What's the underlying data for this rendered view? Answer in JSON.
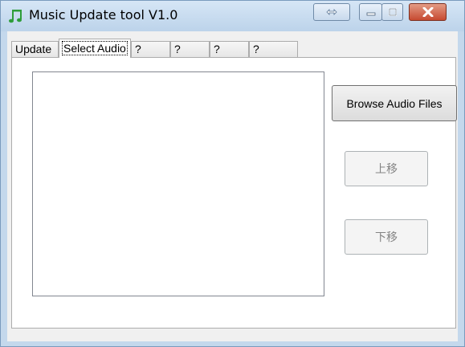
{
  "window": {
    "title": "Music Update tool V1.0"
  },
  "tabs": [
    {
      "label": "Update",
      "selected": false
    },
    {
      "label": "Select Audio",
      "selected": true
    },
    {
      "label": "?",
      "selected": false
    },
    {
      "label": "?",
      "selected": false
    },
    {
      "label": "?",
      "selected": false
    },
    {
      "label": "?",
      "selected": false
    }
  ],
  "buttons": {
    "browse": "Browse Audio Files",
    "move_up": "上移",
    "move_down": "下移"
  },
  "icons": {
    "app": "music-note-icon",
    "extra": "arrows-icon",
    "minimize": "minimize-icon",
    "maximize": "maximize-icon",
    "close": "close-icon"
  },
  "colors": {
    "close_button": "#c74a31",
    "frame": "#c4d8ec",
    "app_icon": "#2e9d3a"
  }
}
